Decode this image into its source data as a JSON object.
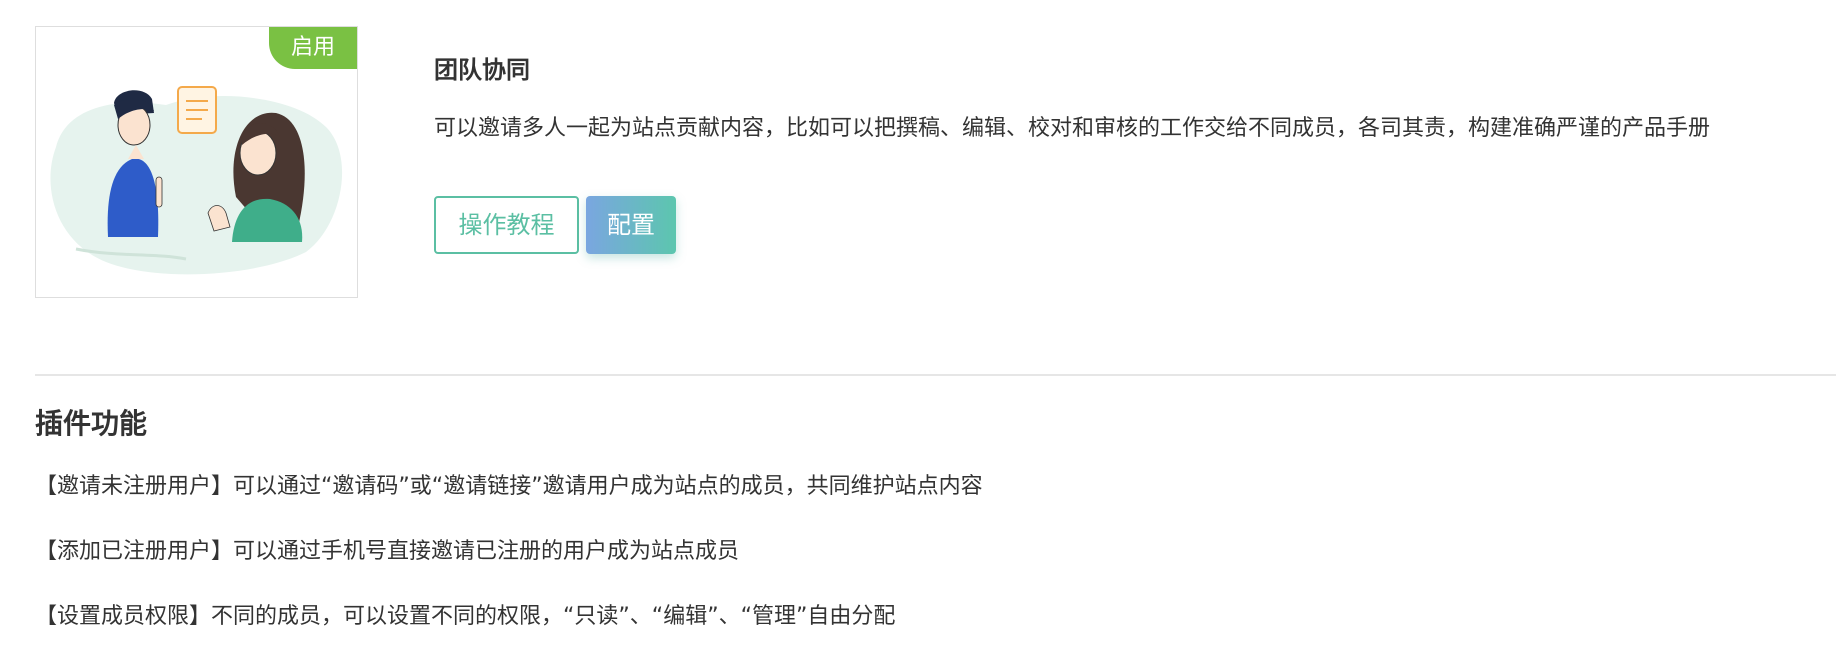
{
  "plugin": {
    "status_badge": "启用",
    "illustration_icon": "team-collaboration-illustration",
    "title": "团队协同",
    "description": "可以邀请多人一起为站点贡献内容，比如可以把撰稿、编辑、校对和审核的工作交给不同成员，各司其责，构建准确严谨的产品手册"
  },
  "actions": {
    "tutorial_label": "操作教程",
    "config_label": "配置"
  },
  "features_section": {
    "title": "插件功能",
    "items": [
      "【邀请未注册用户】可以通过“邀请码”或“邀请链接”邀请用户成为站点的成员，共同维护站点内容",
      "【添加已注册用户】可以通过手机号直接邀请已注册的用户成为站点成员",
      "【设置成员权限】不同的成员，可以设置不同的权限，“只读”、“编辑”、“管理”自由分配"
    ]
  },
  "colors": {
    "badge_green": "#7ac143",
    "accent_teal": "#5bbfa3",
    "gradient_blue": "#7aa6e0",
    "gradient_green": "#5cc6ae"
  }
}
